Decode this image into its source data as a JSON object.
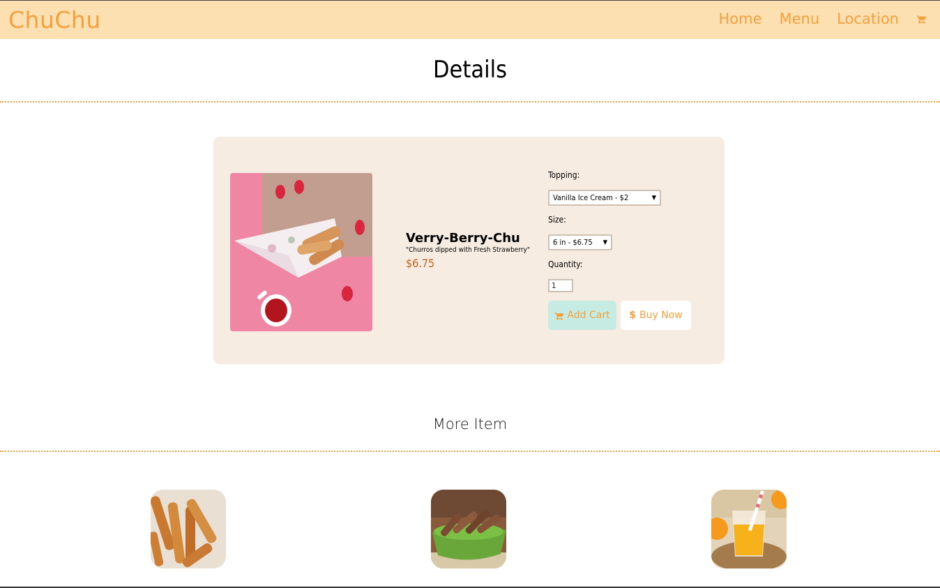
{
  "nav": {
    "brand": "ChuChu",
    "links": [
      "Home",
      "Menu",
      "Location"
    ],
    "cart_icon": "cart-icon"
  },
  "page_title": "Details",
  "product": {
    "name": "Verry-Berry-Chu",
    "description": "\"Churros dipped with Fresh Strawberry\"",
    "price": "$6.75",
    "image_icon": "churro-strawberry-photo"
  },
  "form": {
    "topping_label": "Topping:",
    "topping_value": "Vanilla Ice Cream - $2",
    "size_label": "Size:",
    "size_value": "6 in - $6.75",
    "quantity_label": "Quantity:",
    "quantity_value": "1",
    "add_cart_label": "Add Cart",
    "buy_now_label": "Buy Now"
  },
  "more_title": "More Item",
  "more_items": [
    {
      "icon": "churros-photo"
    },
    {
      "icon": "churro-bowl-photo"
    },
    {
      "icon": "orange-juice-photo"
    }
  ],
  "colors": {
    "accent": "#f4a03c",
    "navbar_bg": "#fce0b2",
    "card_bg": "#f7ece2",
    "price": "#c0651d",
    "add_cart_bg": "#c6ebe3"
  }
}
